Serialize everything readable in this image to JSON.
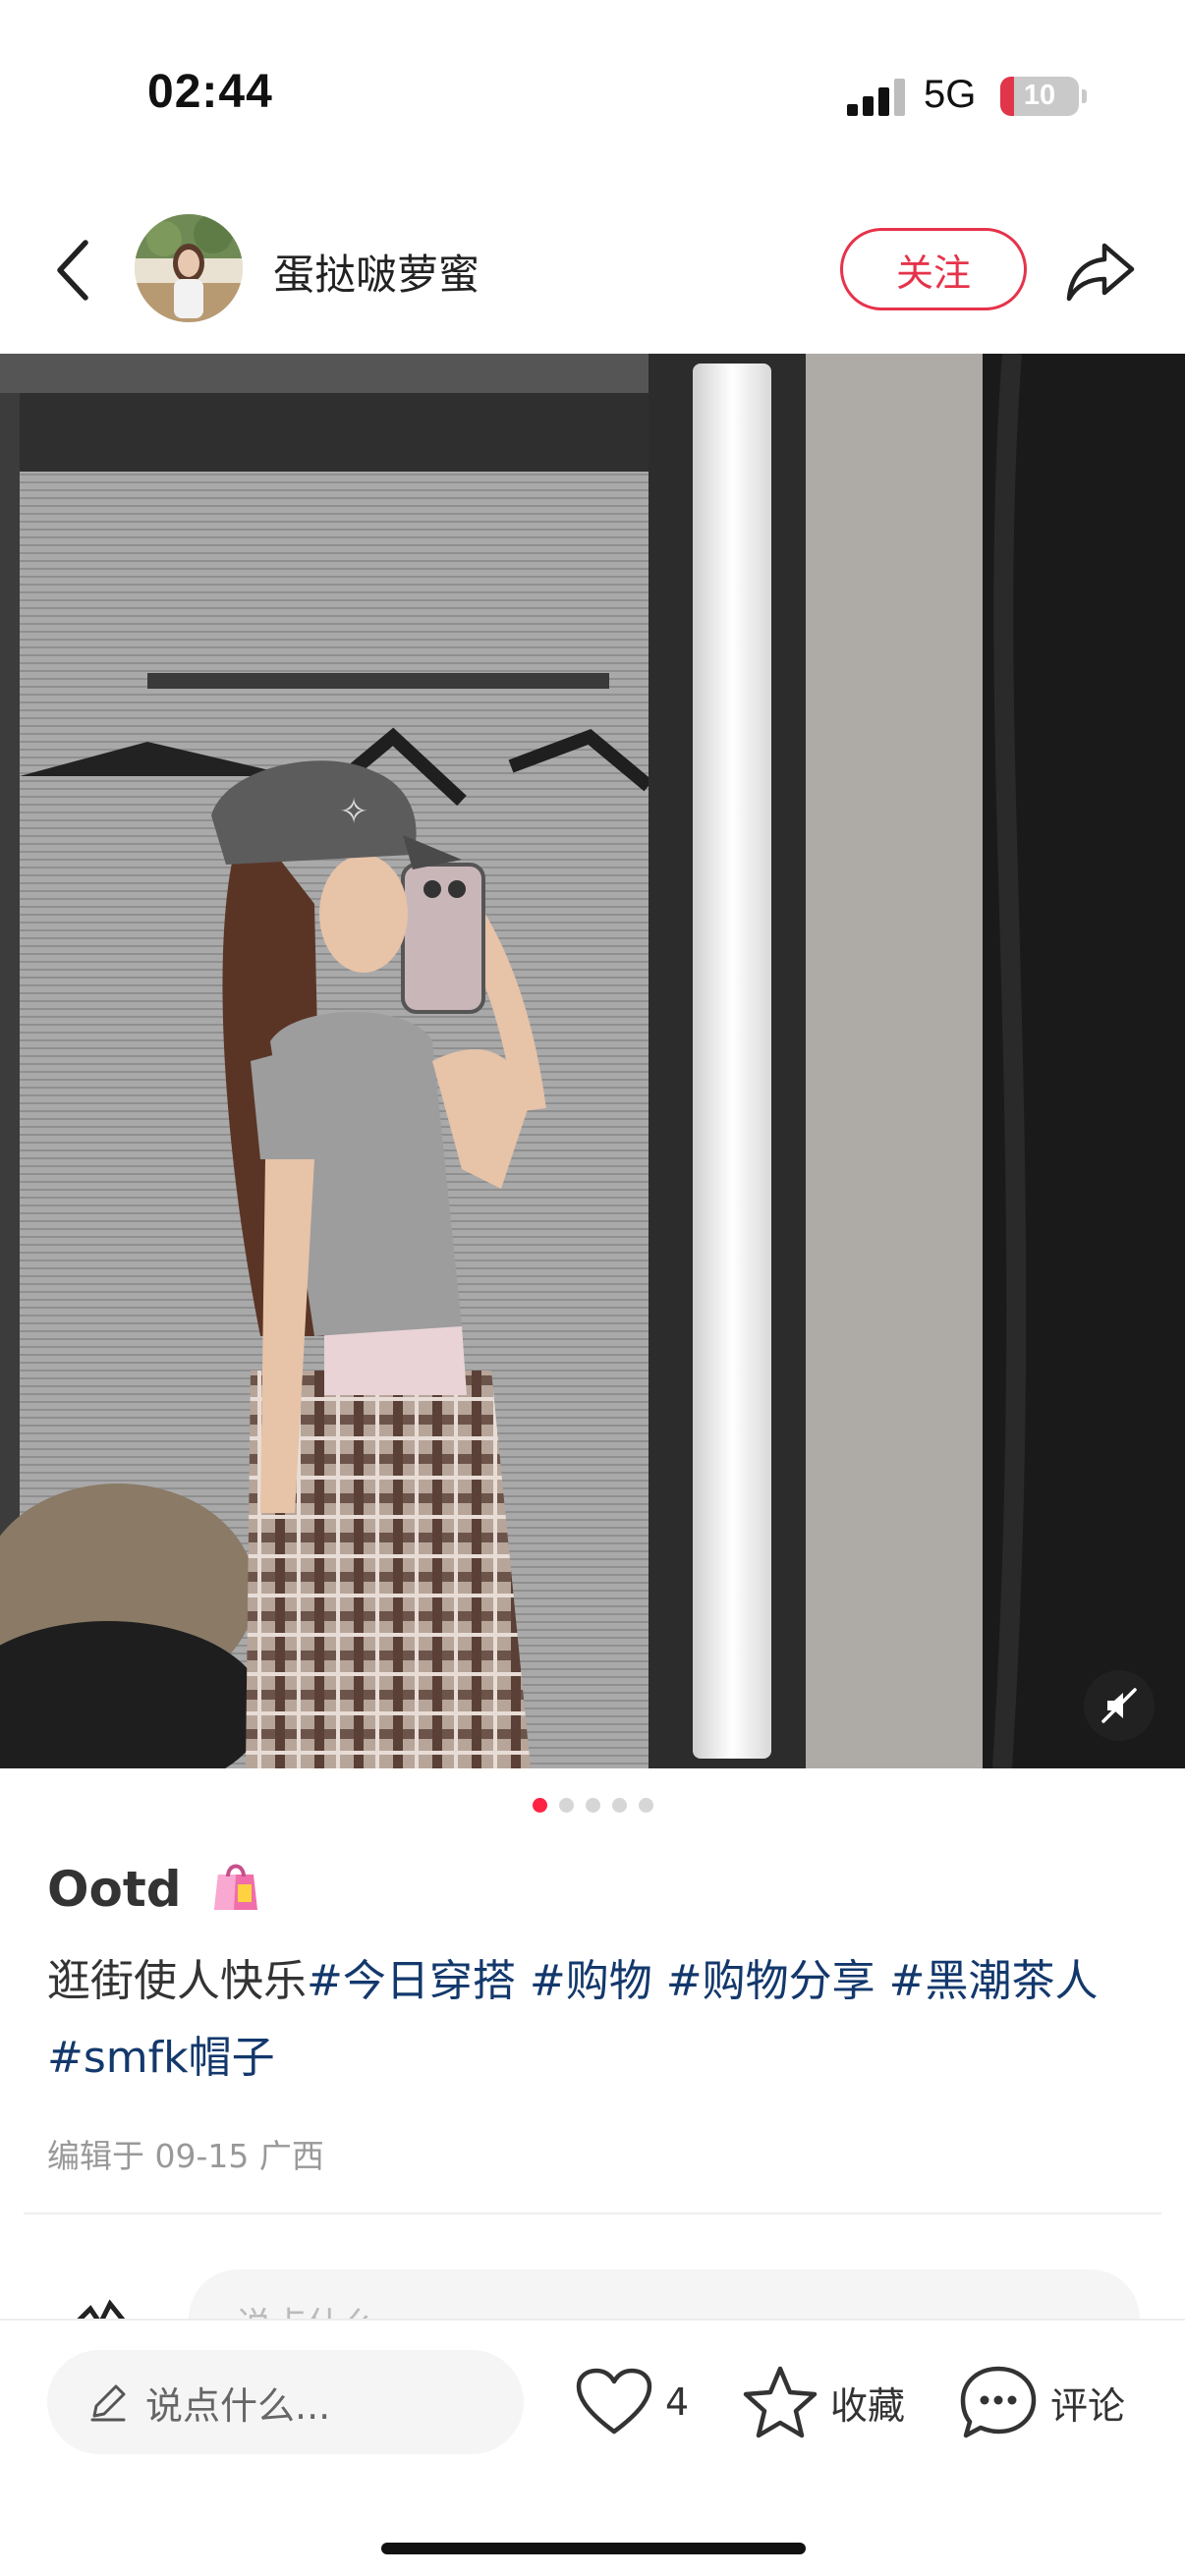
{
  "status_bar": {
    "time": "02:44",
    "network": "5G",
    "battery": "10"
  },
  "header": {
    "author_name": "蛋挞啵萝蜜",
    "follow_label": "关注"
  },
  "carousel": {
    "total": 5,
    "active_index": 0
  },
  "post": {
    "title": "Ootd",
    "body_text": "逛街使人快乐",
    "tags": [
      "#今日穿搭",
      "#购物",
      "#购物分享",
      "#黑潮茶人",
      "#smfk帽子"
    ],
    "meta": "编辑于 09-15 广西"
  },
  "comment_peek": {
    "placeholder": "说点什么"
  },
  "bottom_bar": {
    "comment_placeholder": "说点什么...",
    "like_count": "4",
    "collect_label": "收藏",
    "comment_label": "评论"
  },
  "colors": {
    "accent": "#ff2442",
    "follow": "#e6334a",
    "tag": "#13386c"
  },
  "icons": [
    "back-arrow-icon",
    "share-icon",
    "mute-icon",
    "shopping-bag-icon",
    "pencil-icon",
    "heart-icon",
    "star-icon",
    "comment-bubble-icon"
  ]
}
